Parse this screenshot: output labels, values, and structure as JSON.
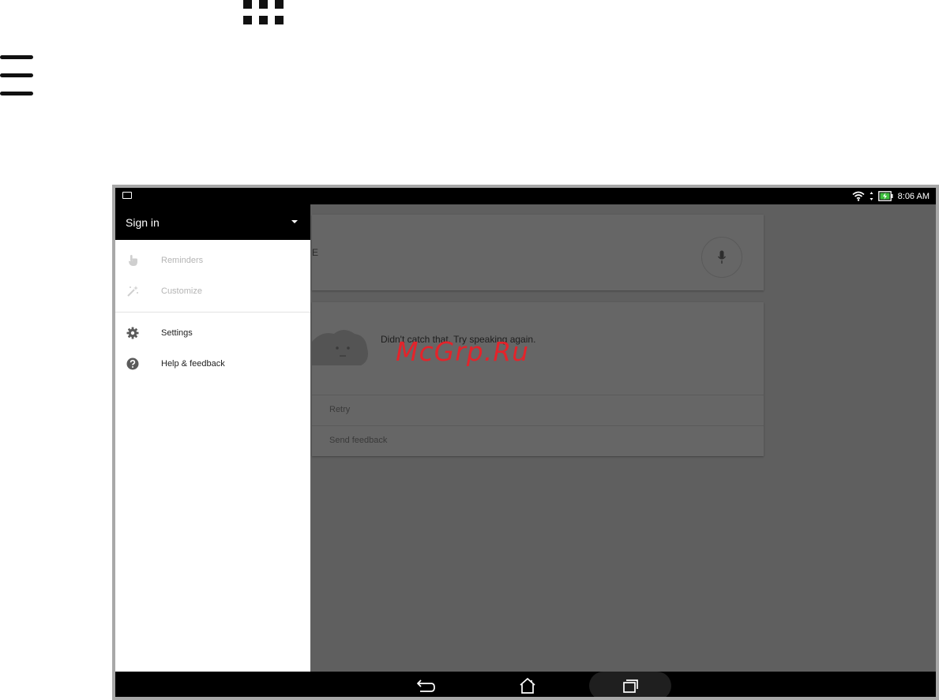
{
  "page_icons": {
    "apps_grid_icon": "apps-grid-icon",
    "menu_icon": "hamburger-menu-icon"
  },
  "status_bar": {
    "time": "8:06 AM",
    "icons": [
      "image-notification-icon",
      "wifi-icon",
      "signal-arrows-icon",
      "battery-charging-icon"
    ]
  },
  "drawer": {
    "header": {
      "sign_in_label": "Sign in"
    },
    "items": [
      {
        "label": "Reminders",
        "icon": "reminder-hand-icon",
        "enabled": false
      },
      {
        "label": "Customize",
        "icon": "magic-wand-icon",
        "enabled": false
      },
      {
        "label": "Settings",
        "icon": "gear-icon",
        "enabled": true
      },
      {
        "label": "Help & feedback",
        "icon": "help-icon",
        "enabled": true
      }
    ]
  },
  "background": {
    "search_card": {
      "partial_text": "E",
      "mic_icon": "microphone-icon"
    },
    "error_card": {
      "message": "Didn't catch that. Try speaking again.",
      "actions": [
        {
          "label": "Retry"
        },
        {
          "label": "Send feedback"
        }
      ]
    }
  },
  "watermark": "McGrp.Ru",
  "nav_bar": {
    "buttons": [
      "back-icon",
      "home-icon",
      "recents-icon"
    ]
  },
  "colors": {
    "scrim": "#5f5f5f",
    "drawer_header": "#000000",
    "watermark": "#e3242b"
  }
}
